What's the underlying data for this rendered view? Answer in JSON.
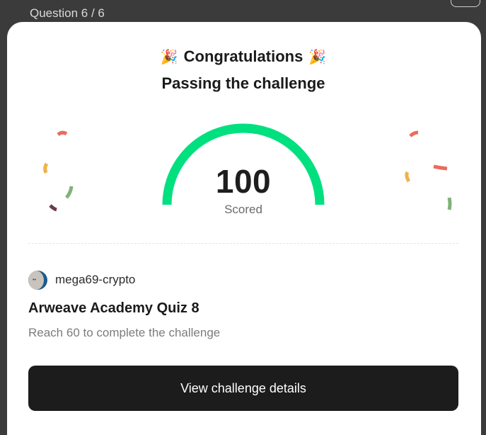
{
  "background": {
    "question_counter": "Question 6 / 6"
  },
  "modal": {
    "title": "Congratulations",
    "title_emoji": "🎉",
    "subtitle": "Passing the challenge",
    "score": {
      "value": "100",
      "label": "Scored",
      "fraction": 1.0
    },
    "user": {
      "name": "mega69-crypto"
    },
    "quiz_title": "Arweave Academy Quiz 8",
    "requirement": "Reach 60 to complete the challenge",
    "cta_label": "View challenge details"
  },
  "colors": {
    "gauge": "#00e07f",
    "cta_bg": "#1c1c1c",
    "confetti": [
      "#ec6b5c",
      "#f0b24a",
      "#7fb378",
      "#6b3a52"
    ]
  }
}
